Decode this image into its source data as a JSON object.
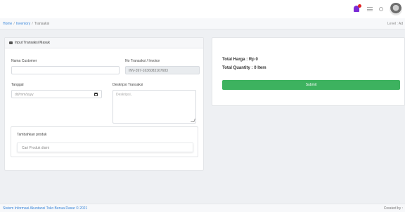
{
  "topbar": {
    "icons": [
      "bell-icon",
      "menu-icon",
      "settings-icon",
      "avatar"
    ],
    "notification_color": "#7a2bd6",
    "badge_color": "#e02424"
  },
  "breadcrumb": {
    "items": [
      "Home",
      "Inventory",
      "Transaksi"
    ],
    "level": "Level : Ad"
  },
  "form": {
    "header": "Input Transaksi Masuk",
    "customer_label": "Nama Customer",
    "customer_value": "",
    "invoice_label": "No Transaksi / Invoice",
    "invoice_value": "INV-397-1636083167683",
    "date_label": "Tanggal",
    "date_placeholder": "dd/mm/yyyy",
    "desc_label": "Deskripsi Transaksi",
    "desc_placeholder": "Deskripsi..",
    "product_title": "Tambahkan produk",
    "product_search_placeholder": "Cari Produk disini"
  },
  "summary": {
    "total_price": "Total Harga   : Rp 0",
    "total_qty": "Total Quantity : 0 Item",
    "submit_label": "Submit",
    "submit_color": "#3db25f"
  },
  "footer": {
    "copyright": "Sistem Informasi Akuntansi Toko Benua Dasar © 2021",
    "credit": "Created by :"
  }
}
